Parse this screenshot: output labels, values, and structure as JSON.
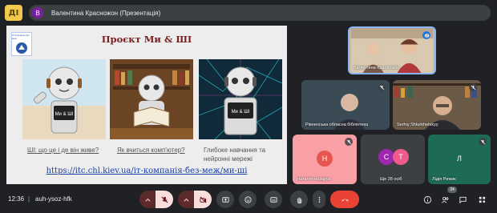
{
  "app": {
    "logo_text": "ДІ"
  },
  "presentation": {
    "avatar_letter": "В",
    "title": "Валентина Красножон (Презентація)"
  },
  "slide": {
    "logo_text": "IT-Компанія без меж",
    "title": "Проєкт Ми & ШІ",
    "panels": [
      {
        "screen_text": "Ми & ШІ",
        "caption": "ШІ: що це і де він живе?",
        "link": true
      },
      {
        "screen_text": "",
        "caption": "Як вчиться комп'ютер?",
        "link": true
      },
      {
        "screen_text": "Ми & ШІ",
        "caption": "Глибоке навчання та нейронні мережі",
        "link": false
      }
    ],
    "url": "https://itc.chl.kiev.ua/іт-компанія-без-меж/ми-ші"
  },
  "participants": [
    {
      "name": "Валентина Красножон",
      "type": "video",
      "speaking": true
    },
    {
      "name": "Рівненська обласна бібліотека",
      "type": "video",
      "muted": true
    },
    {
      "name": "Serhiy Shturkhetskyy",
      "type": "video",
      "muted": true
    },
    {
      "name": "Наталія Назарук",
      "type": "avatar",
      "letter": "Н",
      "color": "#e8554e",
      "bg": "#f9a0a7",
      "muted": true
    },
    {
      "name": "Ще 28 осіб",
      "type": "group",
      "letters": [
        "С",
        "Т"
      ],
      "colors": [
        "#9c27b0",
        "#ef5a8c"
      ],
      "bg": "#3c4043"
    },
    {
      "name": "Лідія Рижик",
      "type": "avatar",
      "letter": "Л",
      "color": "#1e6b55",
      "bg": "#1e6b55",
      "muted": true
    }
  ],
  "meeting": {
    "time": "12:36",
    "divider": "|",
    "code": "auh-ysoz-hfk",
    "participant_count": "34"
  },
  "controls": [
    {
      "name": "mic-options",
      "icon": "chevron-up-icon"
    },
    {
      "name": "microphone",
      "icon": "mic-off-icon",
      "state": "off"
    },
    {
      "name": "camera-options",
      "icon": "chevron-up-icon"
    },
    {
      "name": "camera",
      "icon": "camera-off-icon",
      "state": "off"
    },
    {
      "name": "present",
      "icon": "present-screen-icon"
    },
    {
      "name": "reactions",
      "icon": "emoji-icon"
    },
    {
      "name": "captions",
      "icon": "captions-icon"
    },
    {
      "name": "raise-hand",
      "icon": "hand-icon"
    },
    {
      "name": "more-options",
      "icon": "more-vert-icon"
    },
    {
      "name": "leave-call",
      "icon": "phone-hangup-icon"
    },
    {
      "name": "info",
      "icon": "info-icon"
    },
    {
      "name": "people",
      "icon": "people-icon"
    },
    {
      "name": "chat",
      "icon": "chat-icon"
    },
    {
      "name": "activities",
      "icon": "activities-icon"
    }
  ],
  "colors": {
    "background": "#202124",
    "control_dark": "#3c4043",
    "leave_red": "#ea4335",
    "slide_title": "#7b1e1e",
    "slide_link": "#1a3ea8",
    "active_speaker_border": "#8ab4f8"
  }
}
